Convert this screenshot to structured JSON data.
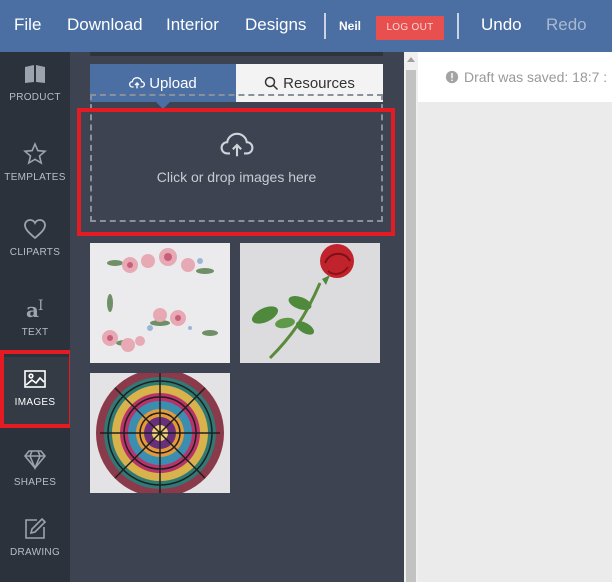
{
  "menu": {
    "file": "File",
    "download": "Download",
    "interior": "Interior",
    "designs": "Designs",
    "user": "Neil",
    "logout": "LOG OUT",
    "undo": "Undo",
    "redo": "Redo"
  },
  "sidebar": {
    "items": [
      {
        "label": "PRODUCT",
        "icon": "book-icon"
      },
      {
        "label": "TEMPLATES",
        "icon": "star-icon"
      },
      {
        "label": "CLIPARTS",
        "icon": "heart-icon"
      },
      {
        "label": "TEXT",
        "icon": "text-icon"
      },
      {
        "label": "IMAGES",
        "icon": "image-icon",
        "active": true
      },
      {
        "label": "SHAPES",
        "icon": "diamond-icon"
      },
      {
        "label": "DRAWING",
        "icon": "pencil-icon"
      }
    ]
  },
  "panel": {
    "tabs": {
      "upload": "Upload",
      "resources": "Resources"
    },
    "dropzone_text": "Click or drop images here",
    "images": [
      {
        "subject": "pink watercolor flowers"
      },
      {
        "subject": "red rose"
      },
      {
        "subject": "colorful mandala"
      }
    ]
  },
  "status": {
    "draft": "Draft was saved: 18:7 :"
  },
  "colors": {
    "topbar": "#4b6fa3",
    "sidebar": "#2c323b",
    "panel": "#3d4350",
    "highlight": "#e41b23",
    "logout": "#e85050"
  }
}
